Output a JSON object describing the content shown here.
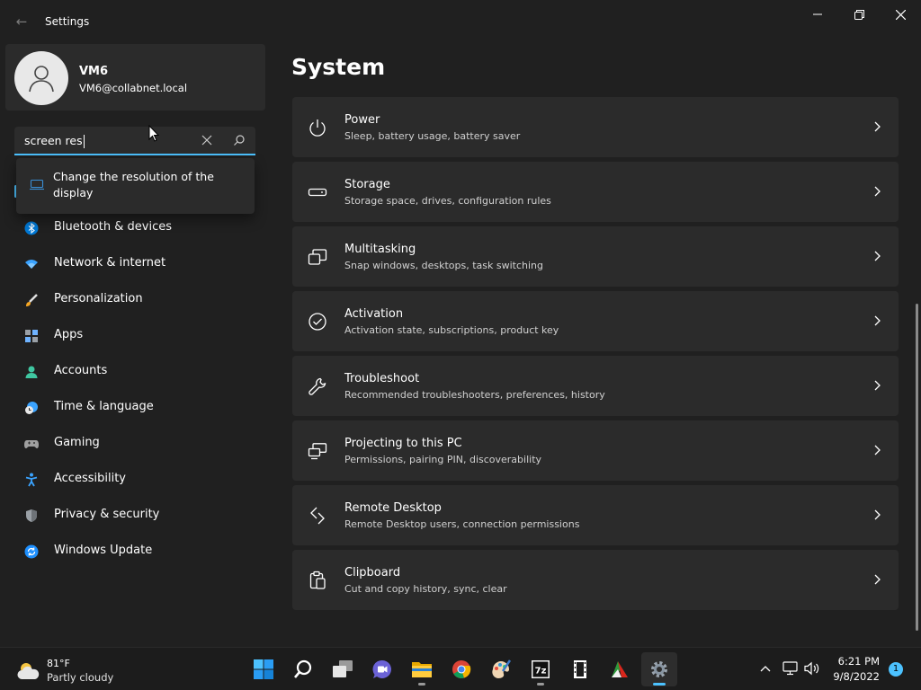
{
  "window": {
    "title": "Settings",
    "back_glyph": "←"
  },
  "profile": {
    "name": "VM6",
    "email": "VM6@collabnet.local"
  },
  "search": {
    "value": "screen res",
    "suggestion": "Change the resolution of the display"
  },
  "sidebar": {
    "items": [
      {
        "label": "Bluetooth & devices",
        "icon": "bluetooth-icon"
      },
      {
        "label": "Network & internet",
        "icon": "wifi-icon"
      },
      {
        "label": "Personalization",
        "icon": "brush-icon"
      },
      {
        "label": "Apps",
        "icon": "apps-icon"
      },
      {
        "label": "Accounts",
        "icon": "accounts-icon"
      },
      {
        "label": "Time & language",
        "icon": "clock-globe-icon"
      },
      {
        "label": "Gaming",
        "icon": "gamepad-icon"
      },
      {
        "label": "Accessibility",
        "icon": "accessibility-icon"
      },
      {
        "label": "Privacy & security",
        "icon": "shield-icon"
      },
      {
        "label": "Windows Update",
        "icon": "update-icon"
      }
    ]
  },
  "main": {
    "title": "System",
    "cards": [
      {
        "title": "Power",
        "subtitle": "Sleep, battery usage, battery saver",
        "icon": "power-icon"
      },
      {
        "title": "Storage",
        "subtitle": "Storage space, drives, configuration rules",
        "icon": "storage-icon"
      },
      {
        "title": "Multitasking",
        "subtitle": "Snap windows, desktops, task switching",
        "icon": "multitasking-icon"
      },
      {
        "title": "Activation",
        "subtitle": "Activation state, subscriptions, product key",
        "icon": "activation-icon"
      },
      {
        "title": "Troubleshoot",
        "subtitle": "Recommended troubleshooters, preferences, history",
        "icon": "wrench-icon"
      },
      {
        "title": "Projecting to this PC",
        "subtitle": "Permissions, pairing PIN, discoverability",
        "icon": "projecting-icon"
      },
      {
        "title": "Remote Desktop",
        "subtitle": "Remote Desktop users, connection permissions",
        "icon": "remote-desktop-icon"
      },
      {
        "title": "Clipboard",
        "subtitle": "Cut and copy history, sync, clear",
        "icon": "clipboard-icon"
      }
    ]
  },
  "taskbar": {
    "weather": {
      "temp": "81°F",
      "condition": "Partly cloudy"
    },
    "apps": [
      "start-icon",
      "search-icon",
      "task-view-icon",
      "teams-chat-icon",
      "file-explorer-icon",
      "chrome-icon",
      "paint-icon",
      "7zip-icon",
      "film-icon",
      "app-icon",
      "settings-icon"
    ],
    "clock": {
      "time": "6:21 PM",
      "date": "9/8/2022"
    },
    "notifications": "1"
  },
  "colors": {
    "accent": "#4cc2ff",
    "card": "#2b2b2b",
    "background": "#202020"
  }
}
